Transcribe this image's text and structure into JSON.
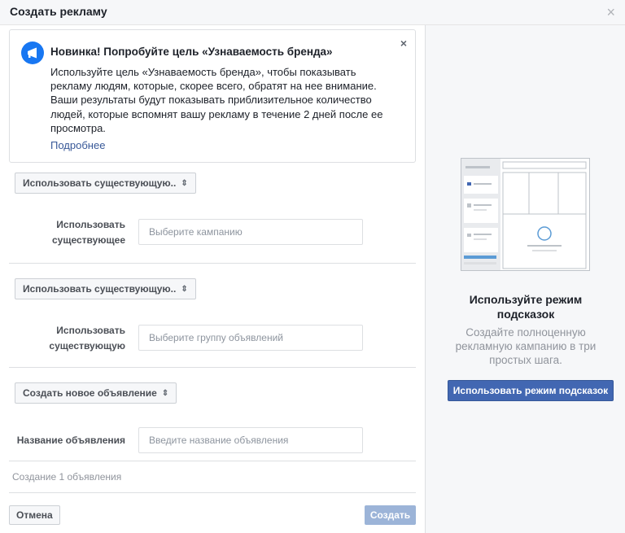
{
  "header": {
    "title": "Создать рекламу",
    "close_icon": "close-icon"
  },
  "notice": {
    "icon": "megaphone-icon",
    "title": "Новинка! Попробуйте цель «Узнаваемость бренда»",
    "body": "Используйте цель «Узнаваемость бренда», чтобы показывать рекламу людям, которые, скорее всего, обратят на нее внимание. Ваши результаты будут показывать приблизительное количество людей, которые вспомнят вашу рекламу в течение 2 дней после ее просмотра.",
    "link": "Подробнее",
    "close_icon": "close-icon"
  },
  "campaign": {
    "select_label": "Использовать существующую..",
    "field_label": "Использовать существующее",
    "placeholder": "Выберите кампанию"
  },
  "adset": {
    "select_label": "Использовать существующую..",
    "field_label": "Использовать существующую",
    "placeholder": "Выберите группу объявлений"
  },
  "ad": {
    "select_label": "Создать новое объявление",
    "field_label": "Название объявления",
    "placeholder": "Введите название объявления"
  },
  "footer": {
    "note": "Создание 1 объявления",
    "cancel_label": "Отмена",
    "create_label": "Создать"
  },
  "guided": {
    "title": "Используйте режим подсказок",
    "description": "Создайте полноценную рекламную кампанию в три простых шага.",
    "button_label": "Использовать режим подсказок"
  },
  "colors": {
    "primary": "#4267b2",
    "link": "#385898",
    "disabled_button": "#9cb4d8",
    "panel_bg": "#f6f7f9"
  }
}
